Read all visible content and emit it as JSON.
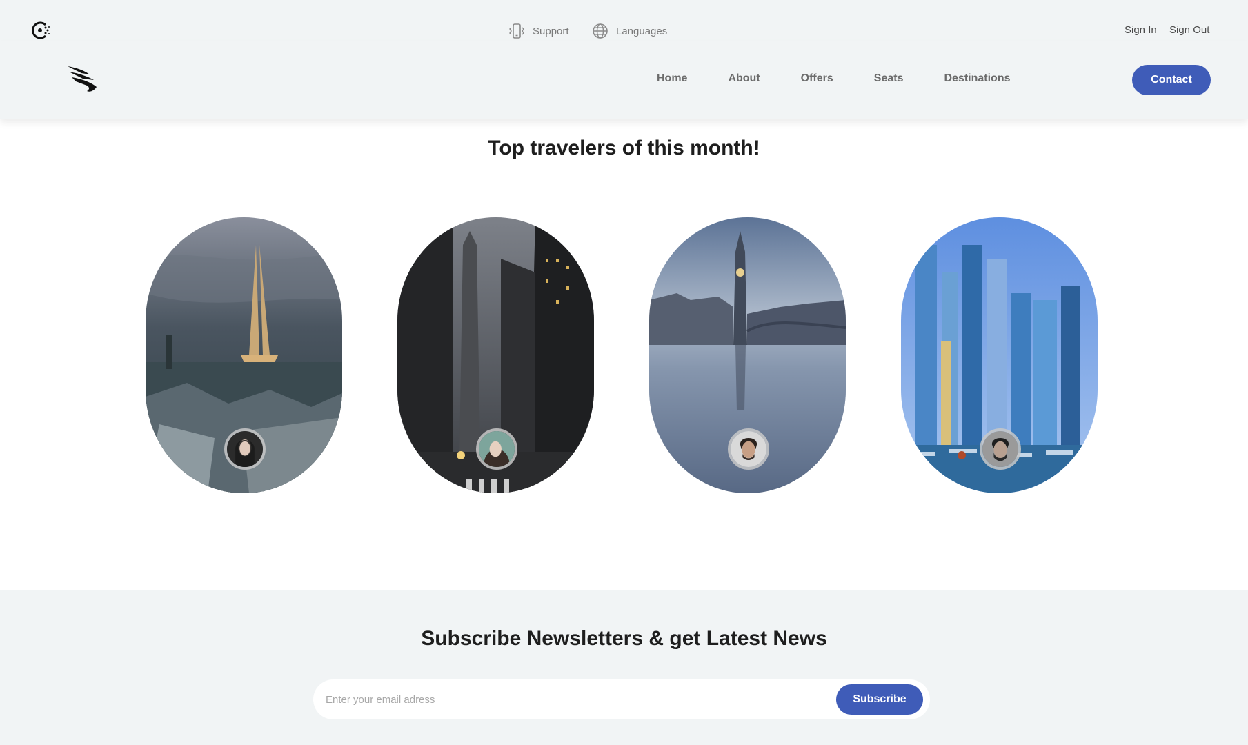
{
  "topbar": {
    "support_label": "Support",
    "languages_label": "Languages",
    "sign_in_label": "Sign In",
    "sign_out_label": "Sign Out"
  },
  "nav": {
    "items": [
      "Home",
      "About",
      "Offers",
      "Seats",
      "Destinations"
    ],
    "contact_label": "Contact"
  },
  "travelers": {
    "title": "Top travelers of this month!",
    "cards": [
      {
        "scene": "paris-eiffel-tower",
        "avatar": "woman-portrait"
      },
      {
        "scene": "new-york-street",
        "avatar": "woman-portrait"
      },
      {
        "scene": "london-big-ben",
        "avatar": "man-portrait"
      },
      {
        "scene": "dubai-marina",
        "avatar": "man-portrait"
      }
    ]
  },
  "newsletter": {
    "title": "Subscribe Newsletters & get Latest News",
    "email_placeholder": "Enter your email adress",
    "subscribe_label": "Subscribe"
  },
  "colors": {
    "accent": "#3f5cb8",
    "header_bg": "#f1f4f5",
    "text_dark": "#1e1e1e",
    "nav_text": "#6b6b6b"
  },
  "icons": [
    "brand-icon",
    "phone-vibrate-icon",
    "globe-icon",
    "wing-logo-icon"
  ]
}
